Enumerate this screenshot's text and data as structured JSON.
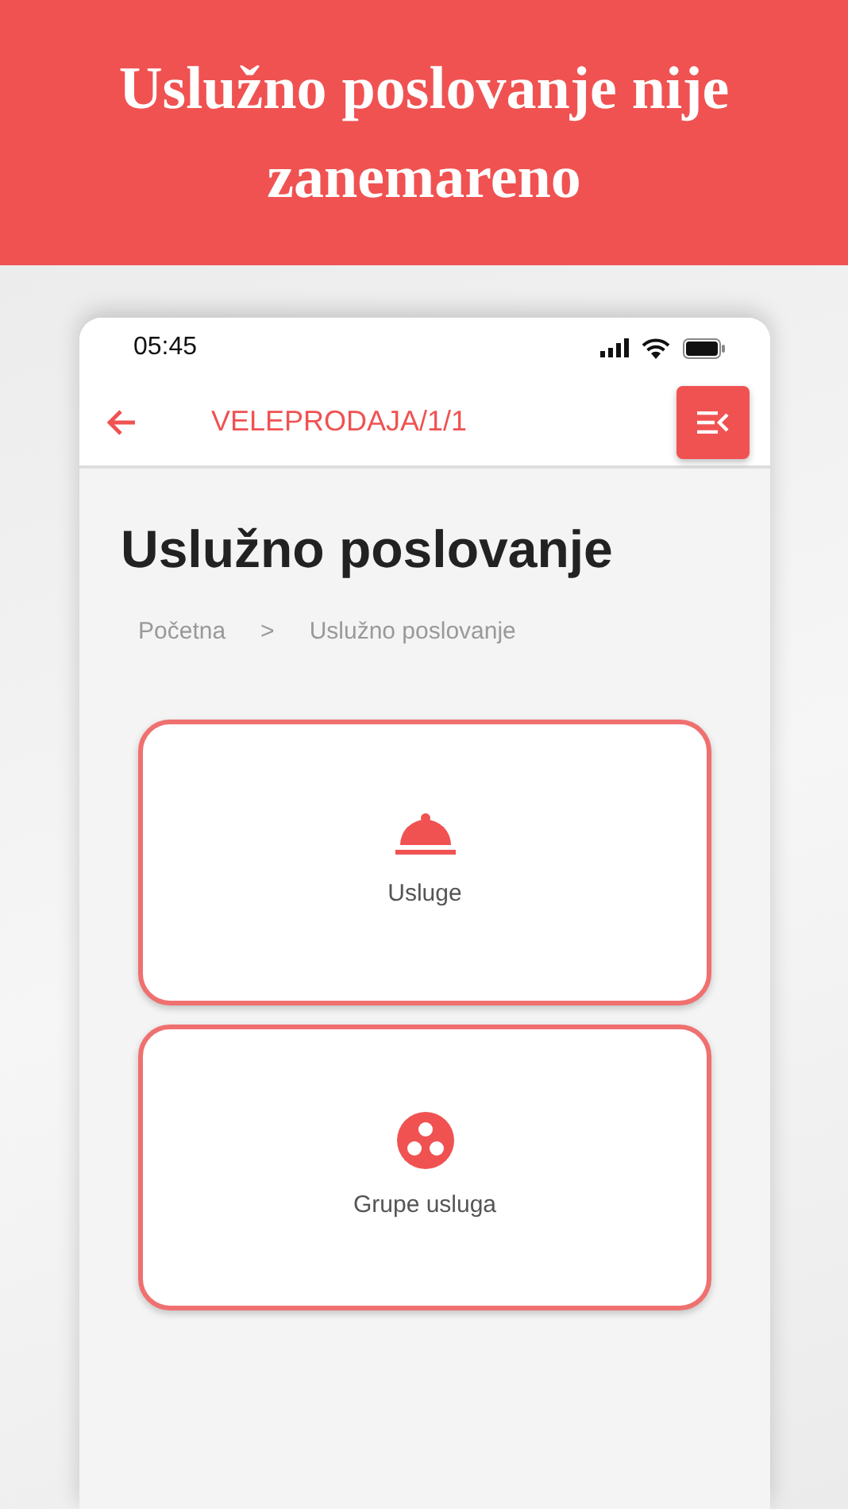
{
  "banner": {
    "title": "Uslužno poslovanje nije zanemareno"
  },
  "status_bar": {
    "time": "05:45"
  },
  "app_bar": {
    "title": "VELEPRODAJA/1/1"
  },
  "page": {
    "title": "Uslužno poslovanje"
  },
  "breadcrumbs": {
    "items": [
      "Početna",
      "Uslužno poslovanje"
    ],
    "separator": ">"
  },
  "tiles": [
    {
      "label": "Usluge",
      "kind": "cloche"
    },
    {
      "label": "Grupe usluga",
      "kind": "group"
    }
  ]
}
